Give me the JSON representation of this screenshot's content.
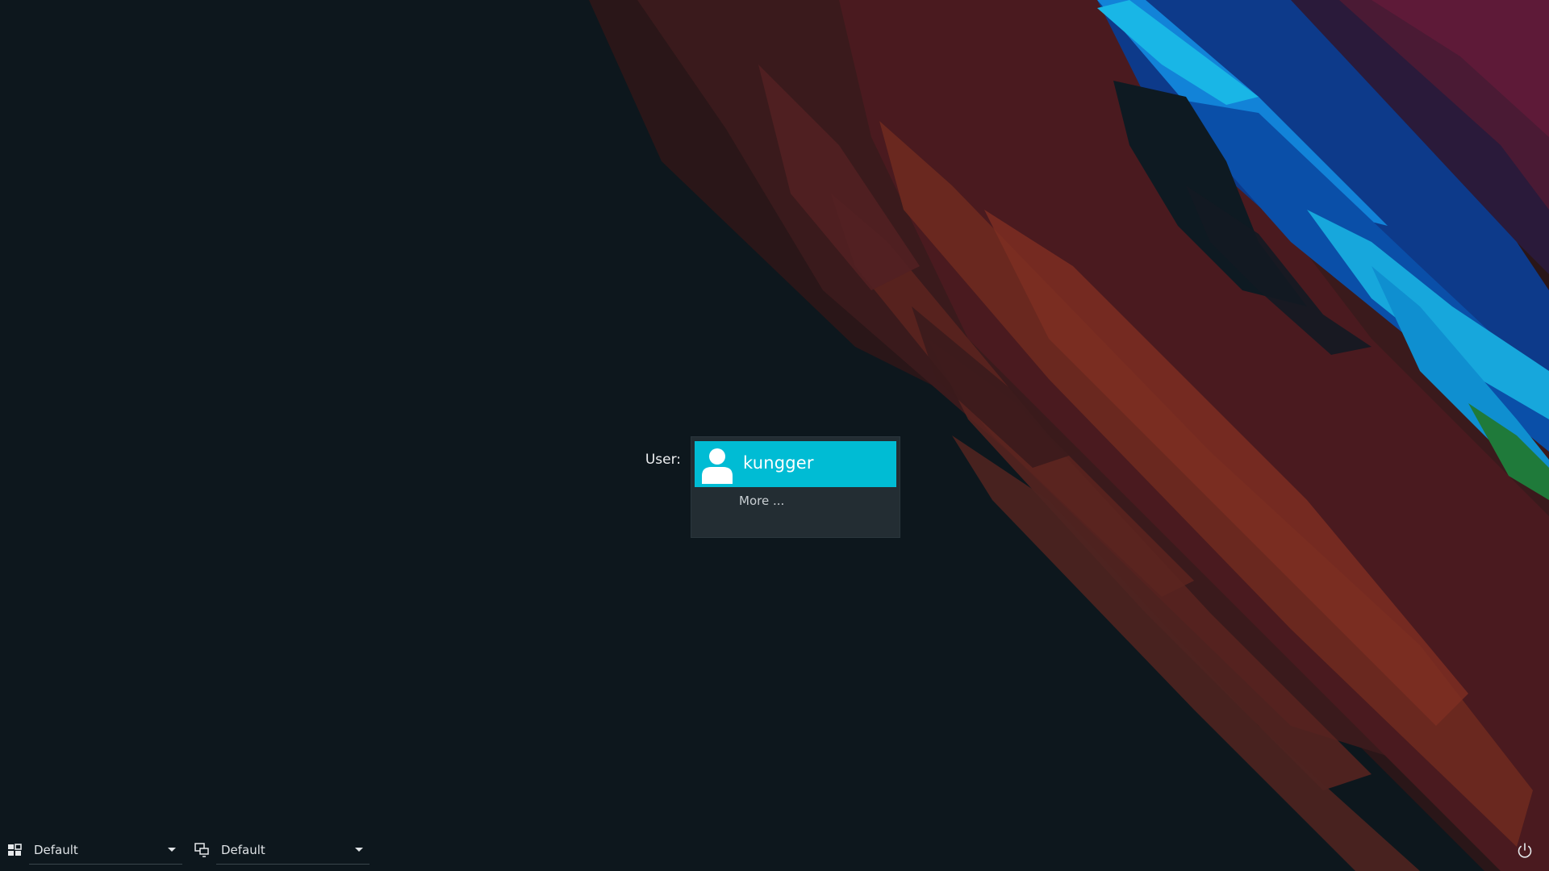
{
  "login": {
    "user_label": "User:",
    "users": [
      {
        "name": "kungger",
        "selected": true
      }
    ],
    "more_label": "More ..."
  },
  "bottom_bar": {
    "desktop_session": {
      "icon": "desktop-session-icon",
      "value": "Default"
    },
    "keyboard_layout": {
      "icon": "keyboard-layout-icon",
      "value": "Default"
    },
    "power": {
      "icon": "power-icon"
    }
  },
  "colors": {
    "background": "#0d171d",
    "accent": "#00bcd4",
    "user_list_bg": "#232d33"
  }
}
